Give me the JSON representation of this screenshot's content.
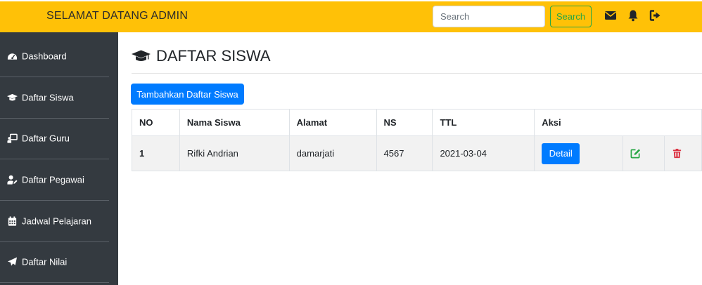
{
  "header": {
    "brand": "SELAMAT DATANG ADMIN",
    "search_placeholder": "Search",
    "search_button": "Search",
    "icons": [
      "envelope-icon",
      "bell-icon",
      "sign-out-icon"
    ]
  },
  "sidebar": {
    "items": [
      {
        "label": "Dashboard",
        "icon": "tachometer-icon"
      },
      {
        "label": "Daftar Siswa",
        "icon": "graduation-cap-icon"
      },
      {
        "label": "Daftar Guru",
        "icon": "chalkboard-teacher-icon"
      },
      {
        "label": "Daftar Pegawai",
        "icon": "user-edit-icon"
      },
      {
        "label": "Jadwal Pelajaran",
        "icon": "calendar-icon"
      },
      {
        "label": "Daftar Nilai",
        "icon": "paper-plane-icon"
      }
    ]
  },
  "main": {
    "title": "DAFTAR SISWA",
    "add_button": "Tambahkan Daftar Siswa",
    "table": {
      "headers": [
        "NO",
        "Nama Siswa",
        "Alamat",
        "NS",
        "TTL",
        "Aksi"
      ],
      "rows": [
        {
          "no": "1",
          "nama": "Rifki Andrian",
          "alamat": "damarjati",
          "ns": "4567",
          "ttl": "2021-03-04",
          "detail": "Detail"
        }
      ]
    }
  },
  "colors": {
    "navbar": "#ffc107",
    "sidebar": "#343a40",
    "primary": "#007bff",
    "success": "#28a745",
    "danger": "#dc3545"
  }
}
